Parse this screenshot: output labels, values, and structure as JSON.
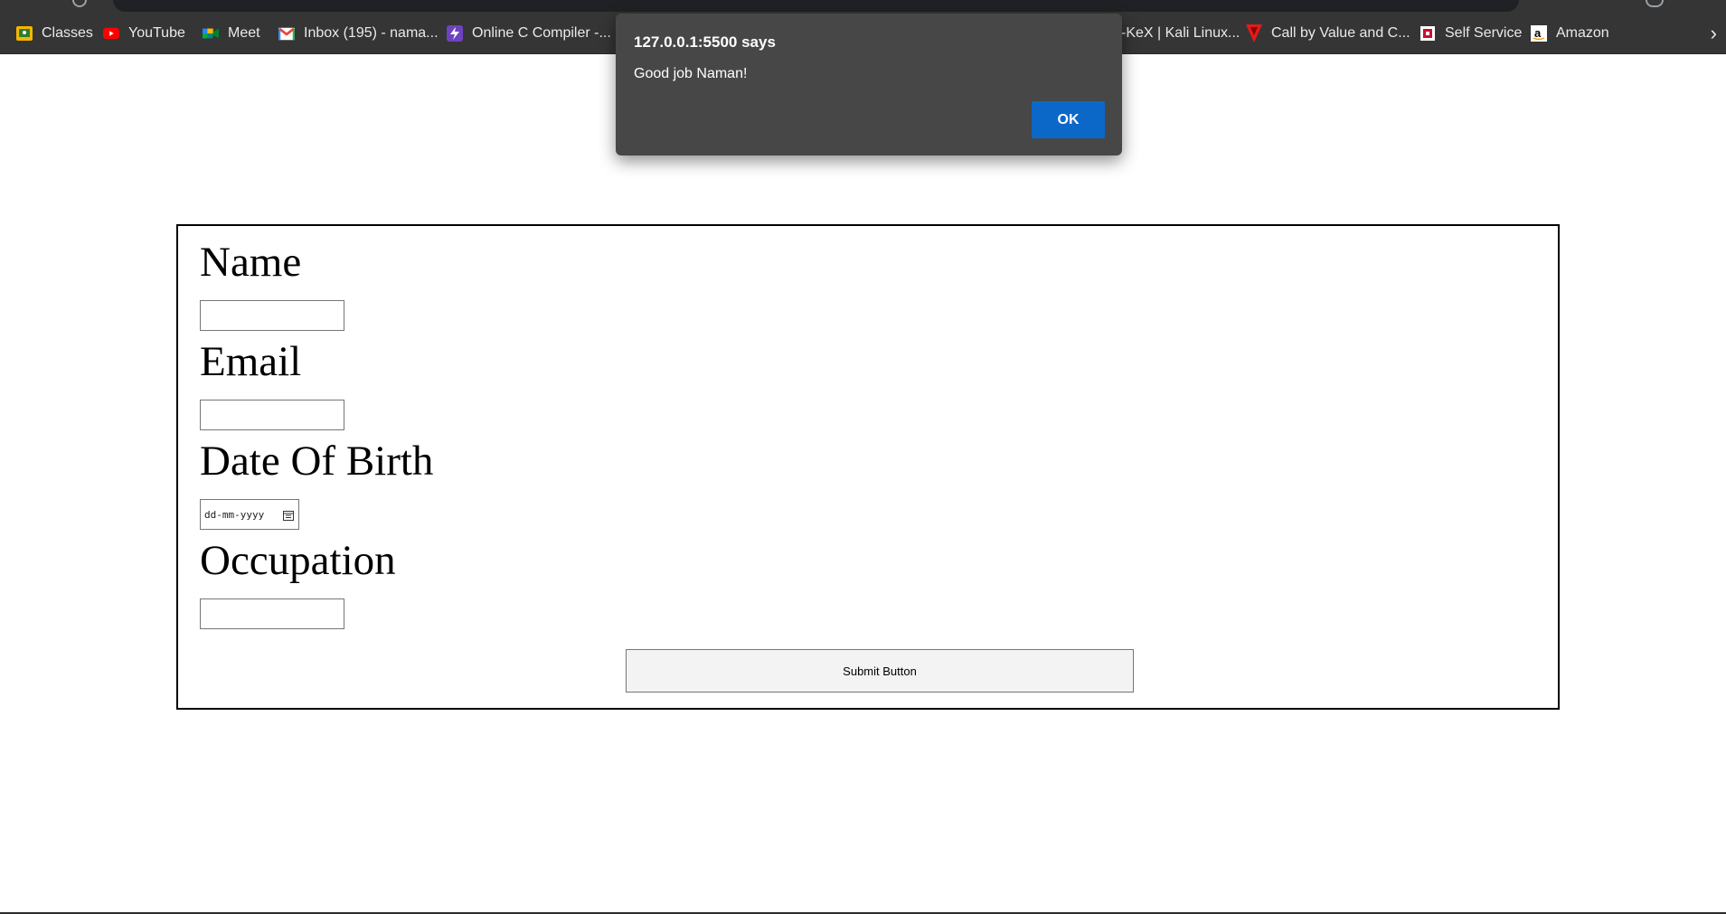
{
  "bookmarks": [
    {
      "label": "Classes",
      "icon": "google-classroom-icon",
      "color": "#f5b700"
    },
    {
      "label": "YouTube",
      "icon": "youtube-icon",
      "color": "#ff0000"
    },
    {
      "label": "Meet",
      "icon": "google-meet-icon",
      "color": "#00897b"
    },
    {
      "label": "Inbox (195) - nama...",
      "icon": "gmail-icon",
      "color": "#ea4335"
    },
    {
      "label": "Online C Compiler -...",
      "icon": "lightning-icon",
      "color": "#6f42c1"
    },
    {
      "label": "-KeX | Kali Linux...",
      "icon": "kali-icon",
      "color": "#2b79c2"
    },
    {
      "label": "Call by Value and C...",
      "icon": "v-logo-icon",
      "color": "#e21b1b"
    },
    {
      "label": "Self Service",
      "icon": "self-service-icon",
      "color": "#c8102e"
    },
    {
      "label": "Amazon",
      "icon": "amazon-icon",
      "color": "#000000"
    }
  ],
  "dialog": {
    "title": "127.0.0.1:5500 says",
    "message": "Good job Naman!",
    "ok_label": "OK",
    "accent": "#0b68c9"
  },
  "form": {
    "name_label": "Name",
    "email_label": "Email",
    "dob_label": "Date Of Birth",
    "dob_placeholder": "dd-mm-yyyy",
    "occupation_label": "Occupation",
    "submit_label": "Submit Button"
  }
}
